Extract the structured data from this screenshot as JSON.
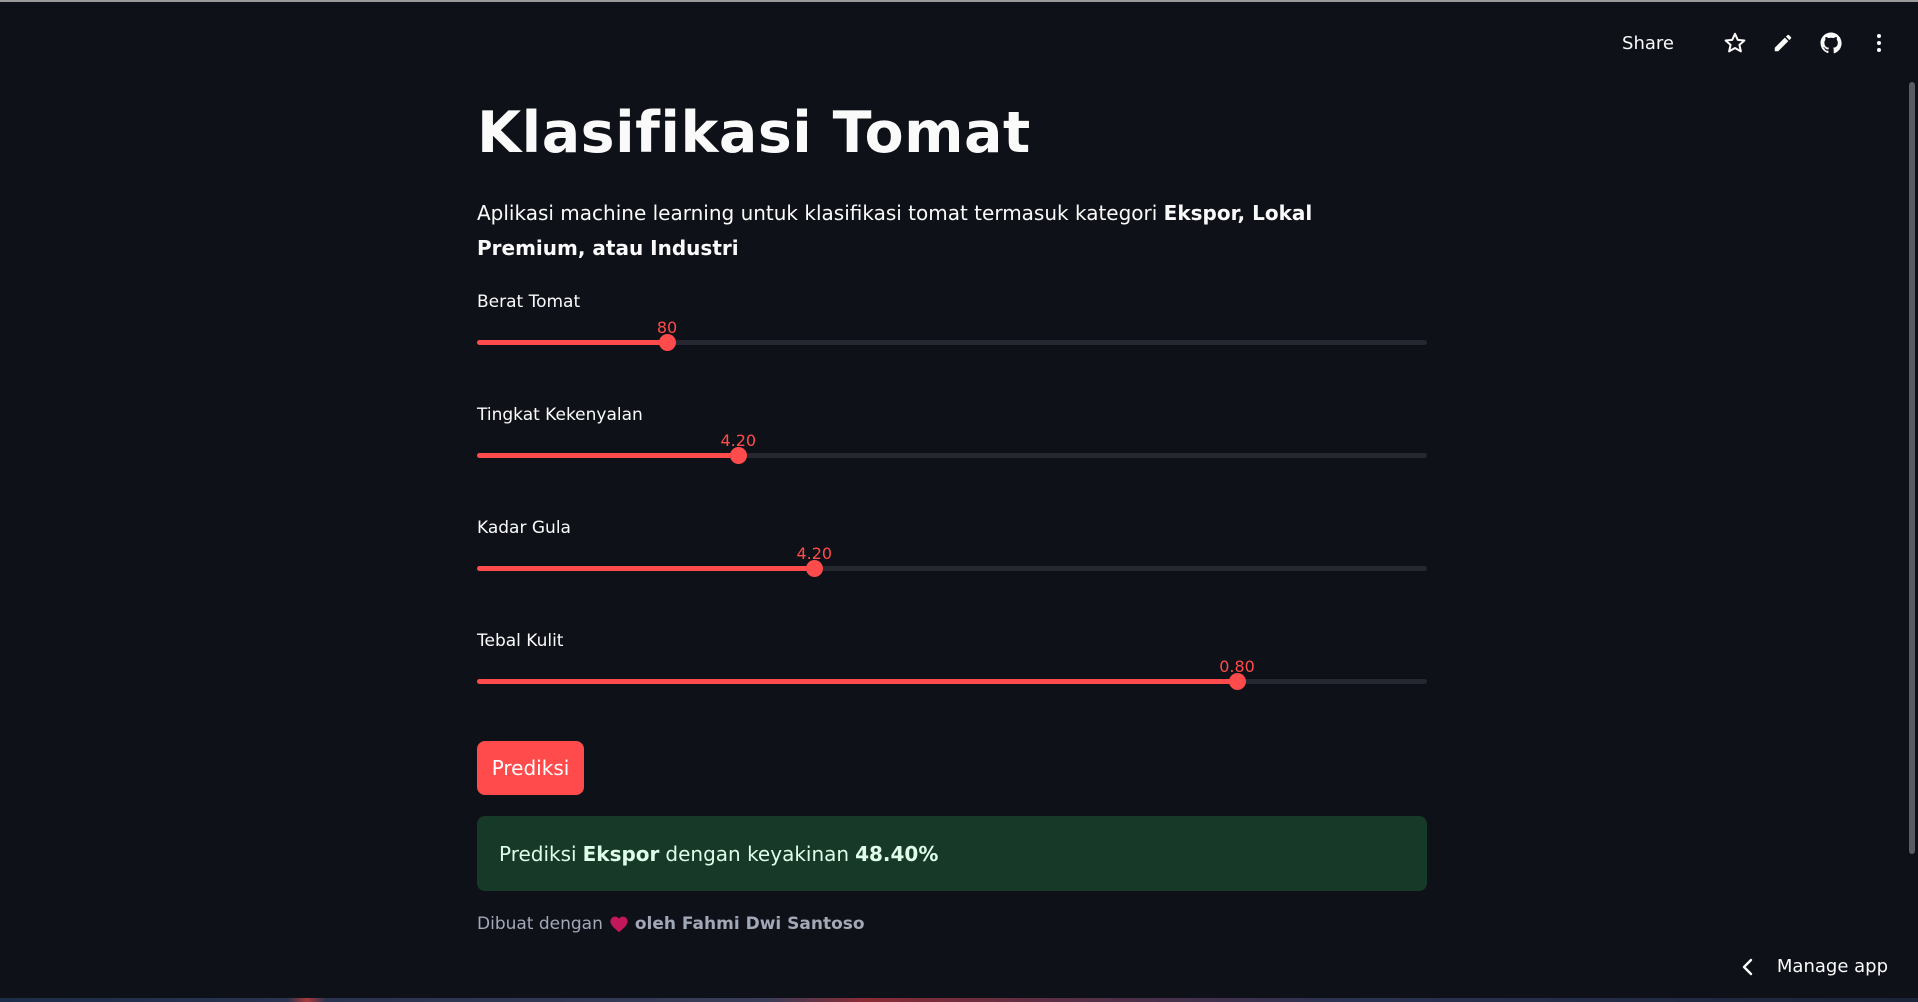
{
  "toolbar": {
    "share_label": "Share",
    "icons": [
      "star-icon",
      "pencil-icon",
      "github-icon",
      "more-vertical-icon"
    ]
  },
  "page": {
    "title": "Klasifikasi Tomat",
    "description": {
      "text": "Aplikasi machine learning untuk klasifikasi tomat termasuk kategori ",
      "bold": "Ekspor, Lokal Premium, atau Industri"
    }
  },
  "sliders": [
    {
      "label": "Berat Tomat",
      "value": "80",
      "fraction": 0.2
    },
    {
      "label": "Tingkat Kekenyalan",
      "value": "4.20",
      "fraction": 0.275
    },
    {
      "label": "Kadar Gula",
      "value": "4.20",
      "fraction": 0.355
    },
    {
      "label": "Tebal Kulit",
      "value": "0.80",
      "fraction": 0.8
    }
  ],
  "button": {
    "label": "Prediksi"
  },
  "result": {
    "prefix": "Prediksi",
    "class_name": "Ekspor",
    "middle": "dengan keyakinan",
    "confidence": "48.40%"
  },
  "footer": {
    "prefix": "Dibuat dengan",
    "heart_icon": "heart-icon",
    "author": "oleh Fahmi Dwi Santoso"
  },
  "manage_app": {
    "label": "Manage app",
    "icon": "chevron-left-icon"
  },
  "colors": {
    "background": "#0e1117",
    "accent": "#ff4b4b",
    "track": "#262730",
    "success_bg": "#173928",
    "success_text": "#dffde9"
  }
}
